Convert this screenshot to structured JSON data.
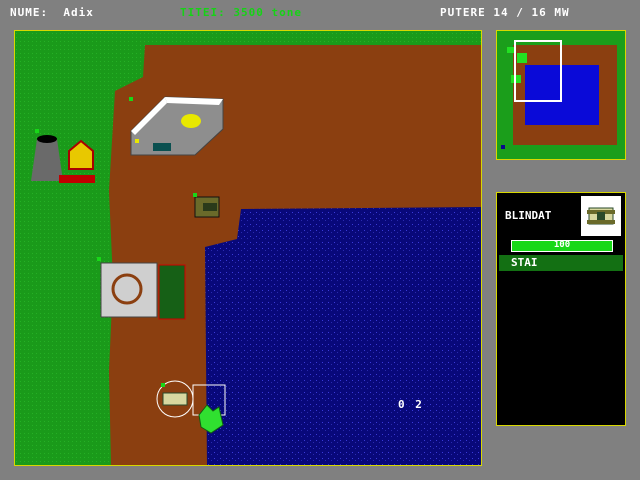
{
  "hud": {
    "name_label": "NUME:",
    "name_value": "Adix",
    "titanium": "TITEI: 3500 tone",
    "power": "PUTERE 14 / 16 MW"
  },
  "panel": {
    "unit_name": "BLINDAT",
    "health": "100",
    "health_fraction": 1.0,
    "status": "STAI"
  },
  "map": {
    "coords": "0 2"
  },
  "icons": {
    "cursor": "green-hand-cursor",
    "portrait": "tank-icon"
  },
  "colors": {
    "grass": "#1a9a1a",
    "dirt": "#8b3f10",
    "water": "#08087a",
    "hud_border": "#d8d800",
    "titanium_text": "#16d216",
    "health_bar": "#18d818",
    "status_bar": "#137013"
  }
}
